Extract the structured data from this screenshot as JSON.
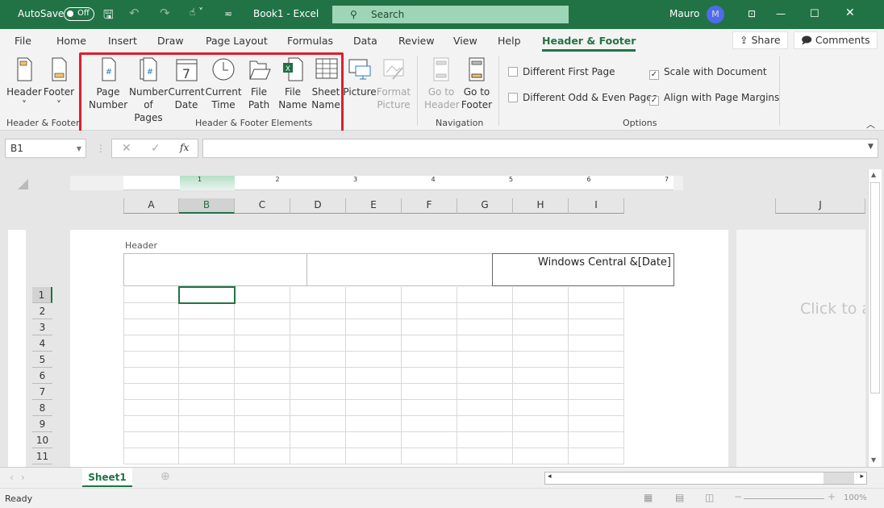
{
  "titlebar": {
    "autosave": "AutoSave",
    "autosave_state": "Off",
    "doc_title": "Book1  -  Excel",
    "search_placeholder": "Search",
    "user": "Mauro",
    "avatar_initial": "M"
  },
  "tabs": [
    {
      "label": "File"
    },
    {
      "label": "Home"
    },
    {
      "label": "Insert"
    },
    {
      "label": "Draw"
    },
    {
      "label": "Page Layout"
    },
    {
      "label": "Formulas"
    },
    {
      "label": "Data"
    },
    {
      "label": "Review"
    },
    {
      "label": "View"
    },
    {
      "label": "Help"
    },
    {
      "label": "Header & Footer",
      "active": true
    }
  ],
  "share": "Share",
  "comments": "Comments",
  "ribbon": {
    "hf": {
      "header": "Header",
      "footer": "Footer",
      "group": "Header & Footer"
    },
    "elements": {
      "items": [
        {
          "l1": "Page",
          "l2": "Number"
        },
        {
          "l1": "Number",
          "l2": "of Pages"
        },
        {
          "l1": "Current",
          "l2": "Date"
        },
        {
          "l1": "Current",
          "l2": "Time"
        },
        {
          "l1": "File",
          "l2": "Path"
        },
        {
          "l1": "File",
          "l2": "Name"
        },
        {
          "l1": "Sheet",
          "l2": "Name"
        },
        {
          "l1": "Picture",
          "l2": ""
        },
        {
          "l1": "Format",
          "l2": "Picture"
        }
      ],
      "group": "Header & Footer Elements"
    },
    "nav": {
      "goto_header_1": "Go to",
      "goto_header_2": "Header",
      "goto_footer_1": "Go to",
      "goto_footer_2": "Footer",
      "group": "Navigation"
    },
    "options": {
      "diff_first": "Different First Page",
      "diff_odd_even": "Different Odd & Even Pages",
      "scale": "Scale with Document",
      "align": "Align with Page Margins",
      "group": "Options",
      "scale_checked": true,
      "align_checked": true,
      "diff_first_checked": false,
      "diff_odd_even_checked": false
    }
  },
  "formula_bar": {
    "name_box": "B1",
    "fx": "fx",
    "value": ""
  },
  "ruler": [
    "1",
    "2",
    "3",
    "4",
    "5",
    "6",
    "7"
  ],
  "columns": [
    "A",
    "B",
    "C",
    "D",
    "E",
    "F",
    "G",
    "H",
    "I"
  ],
  "col_j": "J",
  "rows": [
    "1",
    "2",
    "3",
    "4",
    "5",
    "6",
    "7",
    "8",
    "9",
    "10",
    "11"
  ],
  "header_area": {
    "label": "Header",
    "right_section": "Windows Central &[Date]",
    "next_page_hint": "Click to a"
  },
  "sheet_tabs": [
    {
      "label": "Sheet1",
      "active": true
    }
  ],
  "status": {
    "ready": "Ready",
    "zoom": "100%"
  },
  "colors": {
    "accent": "#217346",
    "highlight": "#e01e2b"
  }
}
